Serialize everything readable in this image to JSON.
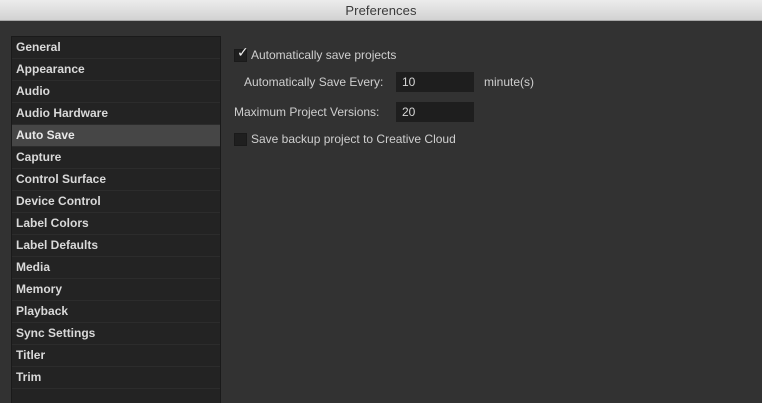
{
  "window": {
    "title": "Preferences"
  },
  "sidebar": {
    "items": [
      {
        "label": "General"
      },
      {
        "label": "Appearance"
      },
      {
        "label": "Audio"
      },
      {
        "label": "Audio Hardware"
      },
      {
        "label": "Auto Save",
        "selected": true
      },
      {
        "label": "Capture"
      },
      {
        "label": "Control Surface"
      },
      {
        "label": "Device Control"
      },
      {
        "label": "Label Colors"
      },
      {
        "label": "Label Defaults"
      },
      {
        "label": "Media"
      },
      {
        "label": "Memory"
      },
      {
        "label": "Playback"
      },
      {
        "label": "Sync Settings"
      },
      {
        "label": "Titler"
      },
      {
        "label": "Trim"
      }
    ]
  },
  "auto_save": {
    "auto_save_checkbox": {
      "label": "Automatically save projects",
      "checked": true
    },
    "save_every": {
      "label": "Automatically Save Every:",
      "value": "10",
      "unit": "minute(s)"
    },
    "max_versions": {
      "label": "Maximum Project Versions:",
      "value": "20"
    },
    "creative_cloud_checkbox": {
      "label": "Save backup project to Creative Cloud",
      "checked": false
    }
  },
  "colors": {
    "background": "#323232",
    "sidebar_background": "#232323",
    "selected_item": "#464646",
    "field_background": "#1e1e1e",
    "text": "#cfcfcf"
  }
}
